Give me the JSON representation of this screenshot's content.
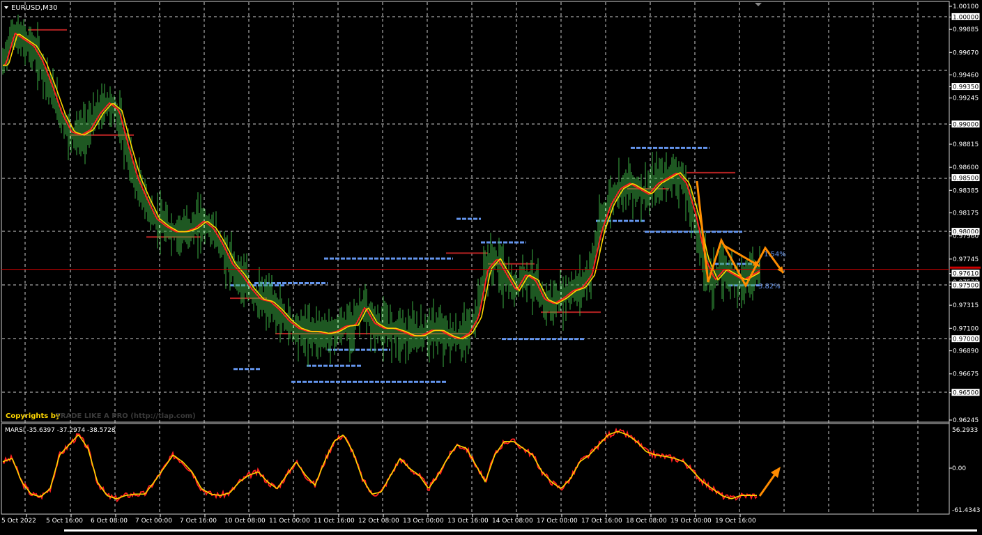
{
  "chart_window": {
    "title": "EURUSD,M30",
    "copyright_prefix": "Copyrights by",
    "copyright_brand": "TRADE LIKE A PRO (http://tlap.com)"
  },
  "indicator_window": {
    "label": "MARSI -35.6397 -37.2974 -38.5728",
    "scale_labels": [
      "56.2933",
      "0.00",
      "-61.4343"
    ]
  },
  "colors": {
    "background": "#000000",
    "candles": "#3cb043",
    "ma_fast": "#ff2020",
    "ma_slow": "#ffd700",
    "levels_blue": "#6495ed",
    "levels_red": "#b22222",
    "projection": "#ff8c00",
    "bid_line": "#cc0000"
  },
  "chart_data": [
    {
      "type": "line",
      "name": "price",
      "symbol": "EURUSD",
      "timeframe": "M30",
      "price_labels": [
        "1.00100",
        "1.00000",
        "0.99885",
        "0.99670",
        "0.99460",
        "0.99350",
        "0.99245",
        "0.99000",
        "0.98815",
        "0.98600",
        "0.98500",
        "0.98385",
        "0.98175",
        "0.98000",
        "0.97960",
        "0.97745",
        "0.97610",
        "0.97530",
        "0.97500",
        "0.97315",
        "0.97100",
        "0.97000",
        "0.96890",
        "0.96675",
        "0.96500",
        "0.96245"
      ],
      "highlighted_levels": [
        "1.00000",
        "0.99350",
        "0.99000",
        "0.98500",
        "0.98000",
        "0.97610",
        "0.97500",
        "0.97000",
        "0.96500"
      ],
      "current_price": "0.97610",
      "time_labels": [
        "5 Oct 2022",
        "5 Oct 16:00",
        "6 Oct 08:00",
        "7 Oct 00:00",
        "7 Oct 16:00",
        "10 Oct 08:00",
        "11 Oct 00:00",
        "11 Oct 16:00",
        "12 Oct 08:00",
        "13 Oct 00:00",
        "13 Oct 16:00",
        "14 Oct 08:00",
        "17 Oct 00:00",
        "17 Oct 16:00",
        "18 Oct 08:00",
        "19 Oct 00:00",
        "19 Oct 16:00"
      ],
      "fib_labels": [
        "1.54%",
        "3.82%"
      ],
      "close_series": [
        0.9955,
        0.9985,
        0.9979,
        0.9973,
        0.9958,
        0.9935,
        0.991,
        0.9893,
        0.989,
        0.9895,
        0.991,
        0.992,
        0.9913,
        0.988,
        0.985,
        0.983,
        0.9812,
        0.9805,
        0.98,
        0.98,
        0.9803,
        0.981,
        0.9803,
        0.9788,
        0.977,
        0.976,
        0.9747,
        0.9737,
        0.9735,
        0.9727,
        0.9717,
        0.971,
        0.9707,
        0.9707,
        0.9705,
        0.9707,
        0.9712,
        0.9713,
        0.973,
        0.9715,
        0.971,
        0.971,
        0.9707,
        0.9703,
        0.9703,
        0.9708,
        0.9708,
        0.9703,
        0.97,
        0.9705,
        0.972,
        0.9765,
        0.9775,
        0.976,
        0.9745,
        0.976,
        0.9755,
        0.9737,
        0.9733,
        0.9738,
        0.9745,
        0.9748,
        0.976,
        0.98,
        0.9825,
        0.984,
        0.9845,
        0.984,
        0.9835,
        0.9845,
        0.985,
        0.9855,
        0.9845,
        0.9815,
        0.9775,
        0.9755,
        0.9765,
        0.976,
        0.9755,
        0.976,
        0.9765
      ]
    },
    {
      "type": "line",
      "name": "MARSI",
      "scale_max": 56.2933,
      "scale_min": -61.4343,
      "values": [
        10,
        15,
        -20,
        -38,
        -42,
        -30,
        20,
        35,
        50,
        30,
        -20,
        -40,
        -45,
        -40,
        -38,
        -38,
        -20,
        0,
        20,
        10,
        -5,
        -30,
        -38,
        -40,
        -36,
        -20,
        -10,
        -5,
        -20,
        -30,
        -10,
        10,
        -10,
        -25,
        10,
        40,
        50,
        25,
        -15,
        -38,
        -35,
        -10,
        15,
        0,
        -10,
        -30,
        -10,
        15,
        35,
        30,
        5,
        -20,
        20,
        40,
        40,
        30,
        20,
        -5,
        -20,
        -30,
        -15,
        10,
        20,
        35,
        50,
        55,
        50,
        40,
        25,
        20,
        18,
        15,
        10,
        -5,
        -20,
        -30,
        -40,
        -45,
        -40,
        -40,
        -40
      ],
      "projection_arrow": "up"
    }
  ]
}
